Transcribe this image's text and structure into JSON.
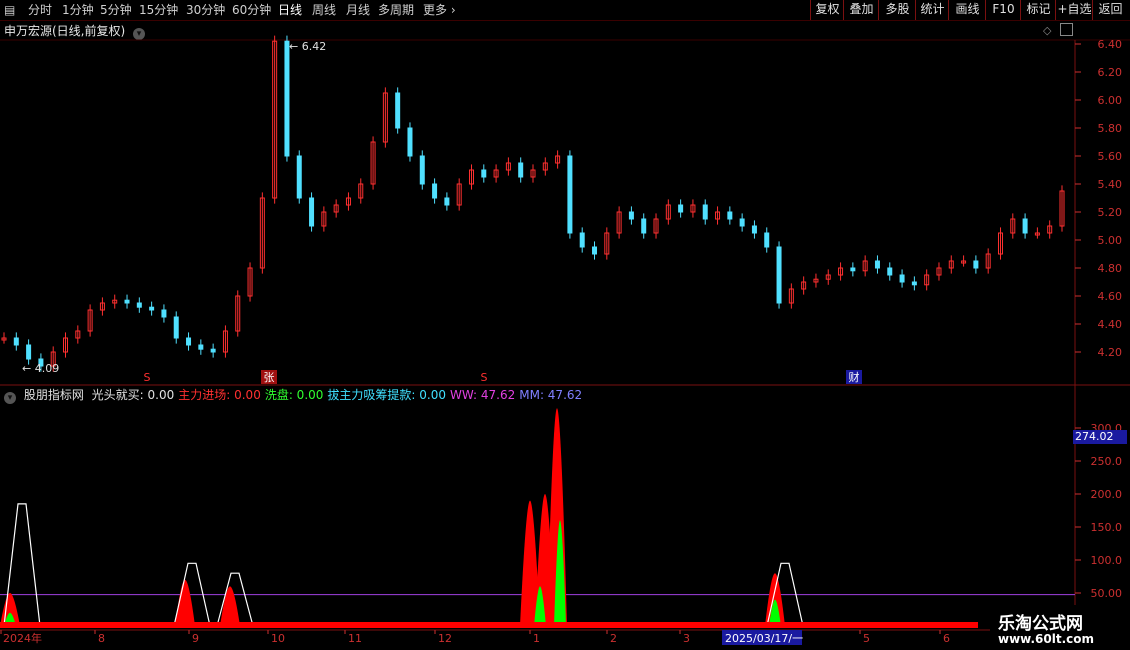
{
  "toolbar": {
    "periods": [
      "分时",
      "1分钟",
      "5分钟",
      "15分钟",
      "30分钟",
      "60分钟",
      "日线",
      "周线",
      "月线",
      "多周期",
      "更多"
    ],
    "active_period": "日线",
    "right_buttons": [
      "复权",
      "叠加",
      "多股",
      "统计",
      "画线",
      "F10",
      "标记",
      "+自选",
      "返回"
    ]
  },
  "title": {
    "stock": "申万宏源(日线,前复权)"
  },
  "indicator": {
    "name": "股朋指标网",
    "items": [
      {
        "label": "光头就买:",
        "value": "0.00",
        "color": "#e0e0e0"
      },
      {
        "label": "主力进场:",
        "value": "0.00",
        "color": "#ff3030"
      },
      {
        "label": "洗盘:",
        "value": "0.00",
        "color": "#30ff30"
      },
      {
        "label": "拔主力吸筹提款:",
        "value": "0.00",
        "color": "#40e0ff"
      },
      {
        "label": "WW:",
        "value": "47.62",
        "color": "#e040e0"
      },
      {
        "label": "MM:",
        "value": "47.62",
        "color": "#8080ff"
      }
    ],
    "current_value": "274.02"
  },
  "markers": {
    "high_label": "6.42",
    "low_label": "4.09",
    "event_zhang": "张",
    "event_cai": "财",
    "event_s": "S"
  },
  "x_axis": {
    "labels": [
      "2024年",
      "8",
      "9",
      "10",
      "11",
      "12",
      "1",
      "2",
      "3",
      "2025/03/17/一",
      "5",
      "6"
    ]
  },
  "watermark": {
    "line1": "乐淘公式网",
    "line2": "www.60lt.com"
  },
  "chart_data": [
    {
      "type": "candlestick",
      "title": "申万宏源(日线,前复权)",
      "y_ticks": [
        "6.40",
        "6.20",
        "6.00",
        "5.80",
        "5.60",
        "5.40",
        "5.20",
        "5.00",
        "4.80",
        "4.60",
        "4.40",
        "4.20"
      ],
      "ylim": [
        4.1,
        6.5
      ],
      "high": 6.42,
      "low": 4.09,
      "segments": [
        {
          "period": "2024-07",
          "values": [
            4.3,
            4.25,
            4.15,
            4.1,
            4.2,
            4.3,
            4.35,
            4.5,
            4.55,
            4.57,
            4.55,
            4.52
          ]
        },
        {
          "period": "2024-08",
          "values": [
            4.5,
            4.45,
            4.3,
            4.25,
            4.22,
            4.2,
            4.35
          ]
        },
        {
          "period": "2024-09",
          "values": [
            4.6,
            4.8,
            5.3,
            6.42,
            5.6,
            5.3,
            5.1,
            5.2,
            5.25,
            5.3
          ]
        },
        {
          "period": "2024-10",
          "values": [
            5.4,
            5.7,
            6.05,
            5.8,
            5.6,
            5.4,
            5.3,
            5.25,
            5.4,
            5.5,
            5.45,
            5.5,
            5.55,
            5.45,
            5.5,
            5.55,
            5.6
          ]
        },
        {
          "period": "2024-12",
          "values": [
            5.05,
            4.95,
            4.9,
            5.05,
            5.2,
            5.15,
            5.05,
            5.15,
            5.25,
            5.2,
            5.25,
            5.15,
            5.2,
            5.15,
            5.1,
            5.05,
            4.95
          ]
        },
        {
          "period": "2025-03",
          "values": [
            4.55,
            4.65,
            4.7,
            4.72,
            4.75,
            4.8,
            4.78,
            4.85,
            4.8,
            4.75,
            4.7,
            4.68,
            4.75,
            4.8,
            4.85,
            4.85,
            4.8,
            4.9,
            5.05,
            5.15,
            5.05,
            5.05,
            5.1,
            5.35
          ]
        }
      ]
    },
    {
      "type": "area",
      "title": "股朋指标网",
      "y_ticks": [
        "300.0",
        "250.0",
        "200.0",
        "150.0",
        "100.0",
        "50.00"
      ],
      "ylim": [
        0,
        330
      ],
      "current": 274.02,
      "series": [
        {
          "name": "主力进场",
          "color": "#ff0000",
          "peaks": [
            [
              10,
              50
            ],
            [
              185,
              70
            ],
            [
              230,
              60
            ],
            [
              530,
              190
            ],
            [
              545,
              200
            ],
            [
              557,
              330
            ],
            [
              775,
              80
            ]
          ]
        },
        {
          "name": "洗盘",
          "color": "#00ff00",
          "peaks": [
            [
              10,
              20
            ],
            [
              540,
              60
            ],
            [
              560,
              160
            ],
            [
              775,
              40
            ]
          ]
        },
        {
          "name": "光头就买",
          "color": "#ffffff",
          "peaks": [
            [
              22,
              185
            ],
            [
              192,
              95
            ],
            [
              235,
              80
            ],
            [
              785,
              95
            ]
          ]
        },
        {
          "name": "WW",
          "color": "#e040e0",
          "level": 47.62
        }
      ]
    }
  ]
}
